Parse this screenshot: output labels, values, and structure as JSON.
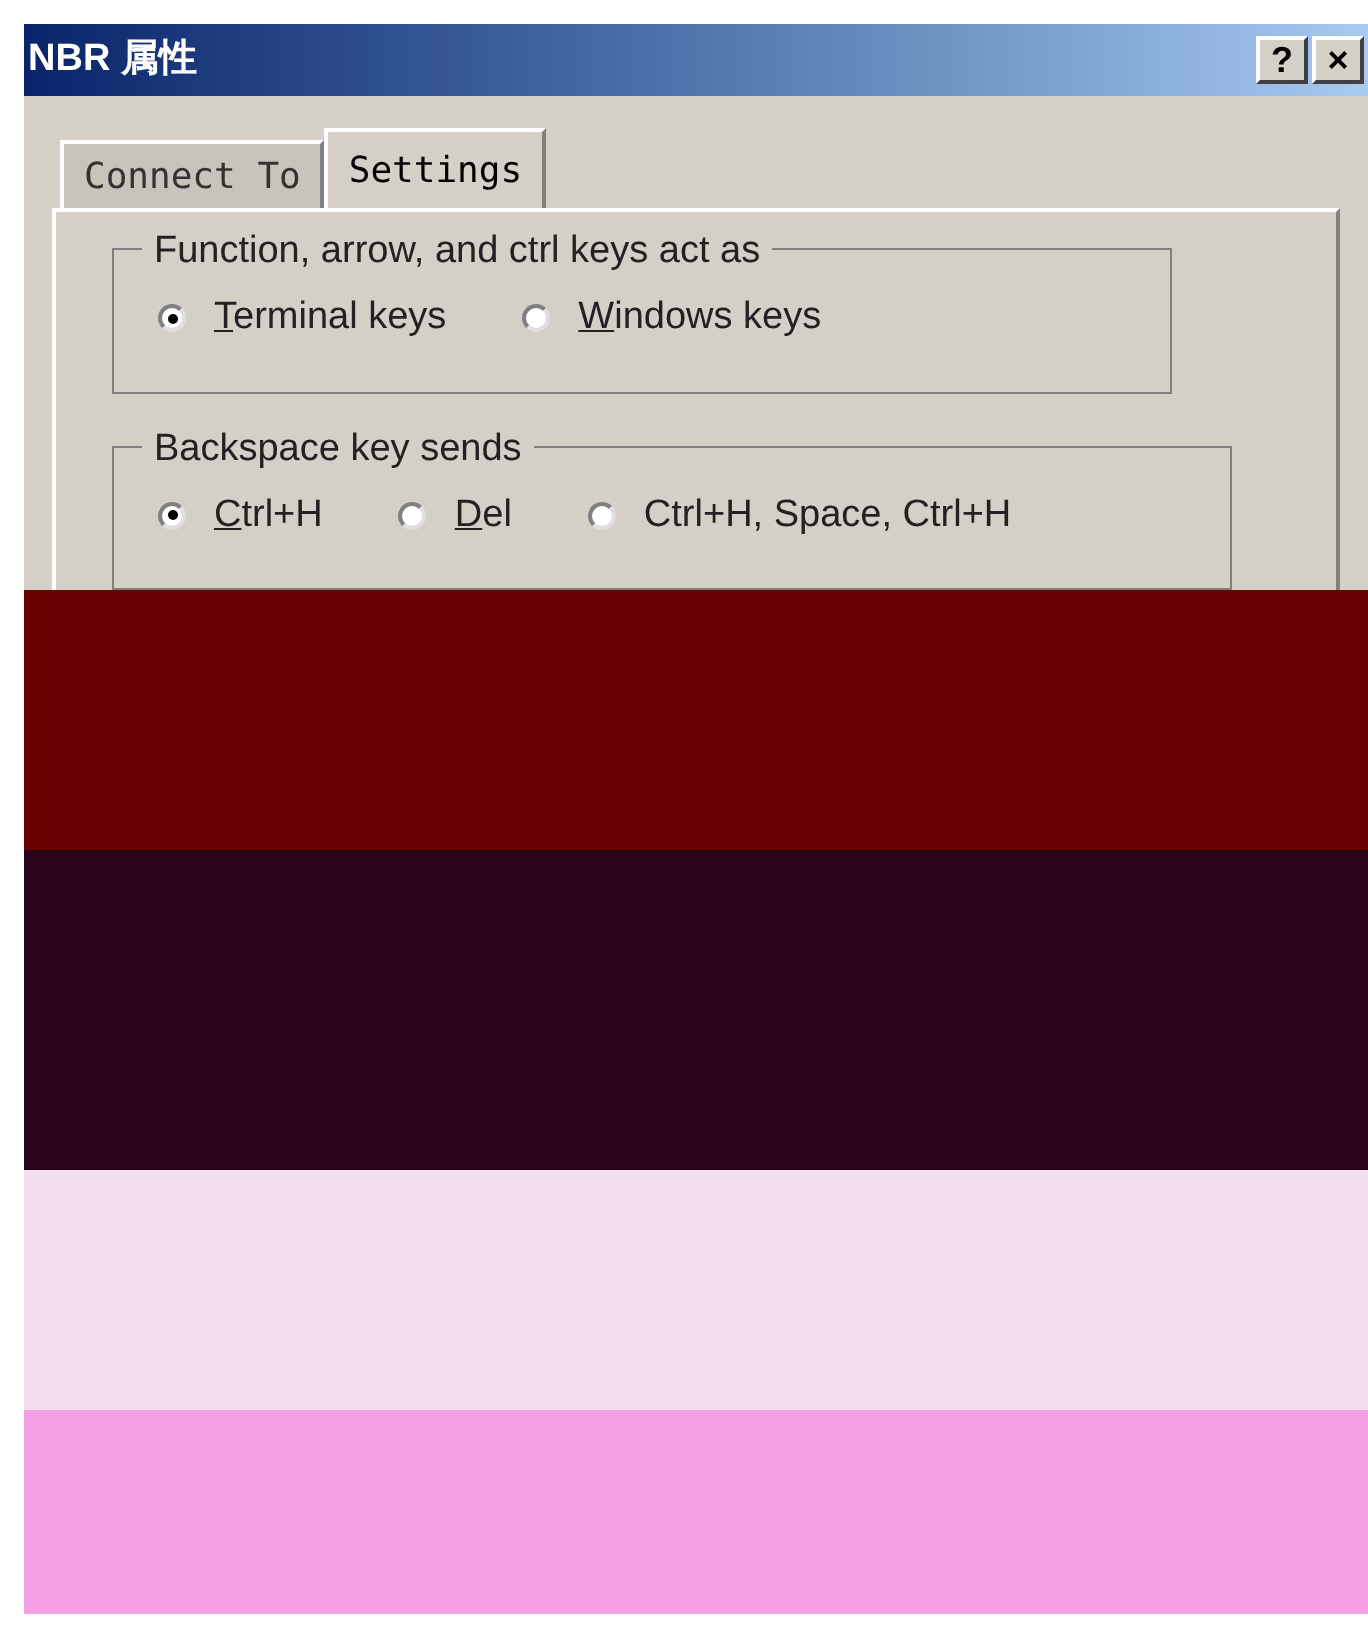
{
  "window": {
    "title": "NBR 属性",
    "buttons": [
      {
        "label": "?"
      },
      {
        "label": "×"
      }
    ]
  },
  "tabs": [
    {
      "label": "Connect To",
      "selected": false
    },
    {
      "label": "Settings",
      "selected": true
    }
  ],
  "groups": [
    {
      "title": "Function, arrow, and ctrl keys act as",
      "options": [
        {
          "label": "Terminal keys",
          "access_key_underlined": true,
          "selected": true
        },
        {
          "label": "Windows keys",
          "access_key_underlined": true,
          "selected": false
        }
      ]
    },
    {
      "title": "Backspace key sends",
      "options": [
        {
          "label": "Ctrl+H",
          "access_key_underlined": true,
          "selected": true
        },
        {
          "label": "Del",
          "access_key_underlined": true,
          "selected": false
        },
        {
          "label": "Ctrl+H, Space, Ctrl+H",
          "access_key_underlined": false,
          "selected": false
        }
      ]
    }
  ]
}
